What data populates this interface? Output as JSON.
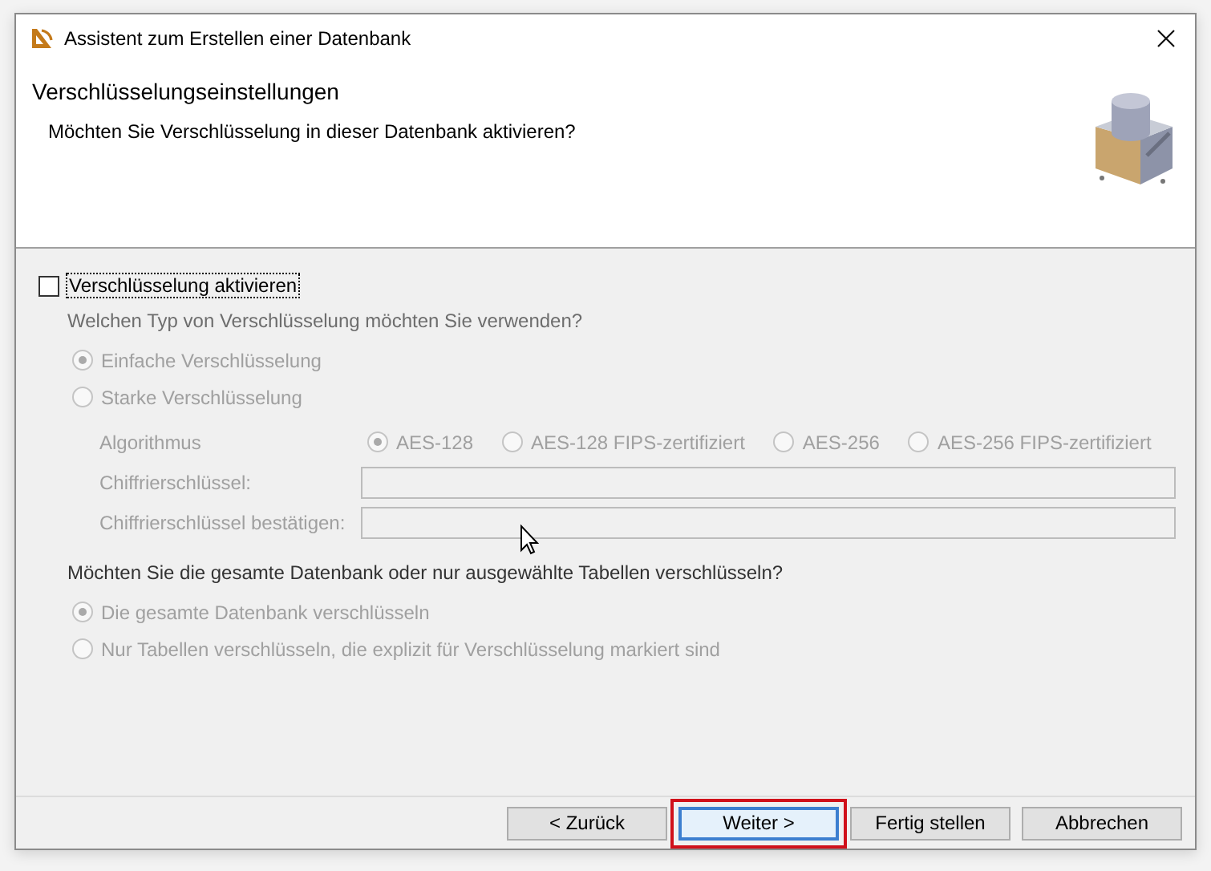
{
  "window": {
    "title": "Assistent zum Erstellen einer Datenbank"
  },
  "header": {
    "title": "Verschlüsselungseinstellungen",
    "subtitle": "Möchten Sie Verschlüsselung in dieser Datenbank aktivieren?"
  },
  "enable_encryption": {
    "label": "Verschlüsselung aktivieren",
    "checked": false,
    "focused": true
  },
  "encryption_type": {
    "question": "Welchen Typ von Verschlüsselung möchten Sie verwenden?",
    "disabled": true,
    "options": [
      {
        "label": "Einfache Verschlüsselung",
        "selected": true
      },
      {
        "label": "Starke Verschlüsselung",
        "selected": false
      }
    ]
  },
  "algorithm": {
    "label": "Algorithmus",
    "disabled": true,
    "options": [
      {
        "label": "AES-128",
        "selected": true
      },
      {
        "label": "AES-128 FIPS-zertifiziert",
        "selected": false
      },
      {
        "label": "AES-256",
        "selected": false
      },
      {
        "label": "AES-256 FIPS-zertifiziert",
        "selected": false
      }
    ]
  },
  "key_fields": [
    {
      "label": "Chiffrierschlüssel:",
      "disabled": true
    },
    {
      "label": "Chiffrierschlüssel bestätigen:",
      "disabled": true
    }
  ],
  "scope": {
    "question": "Möchten Sie die gesamte Datenbank oder nur ausgewählte Tabellen verschlüsseln?",
    "disabled": true,
    "options": [
      {
        "label": "Die gesamte Datenbank verschlüsseln",
        "selected": true
      },
      {
        "label": "Nur Tabellen verschlüsseln, die explizit für Verschlüsselung markiert sind",
        "selected": false
      }
    ]
  },
  "buttons": [
    {
      "label": "< Zurück",
      "default": false,
      "highlighted": false
    },
    {
      "label": "Weiter >",
      "default": true,
      "highlighted": true
    },
    {
      "label": "Fertig stellen",
      "default": false,
      "highlighted": false
    },
    {
      "label": "Abbrechen",
      "default": false,
      "highlighted": false
    }
  ]
}
